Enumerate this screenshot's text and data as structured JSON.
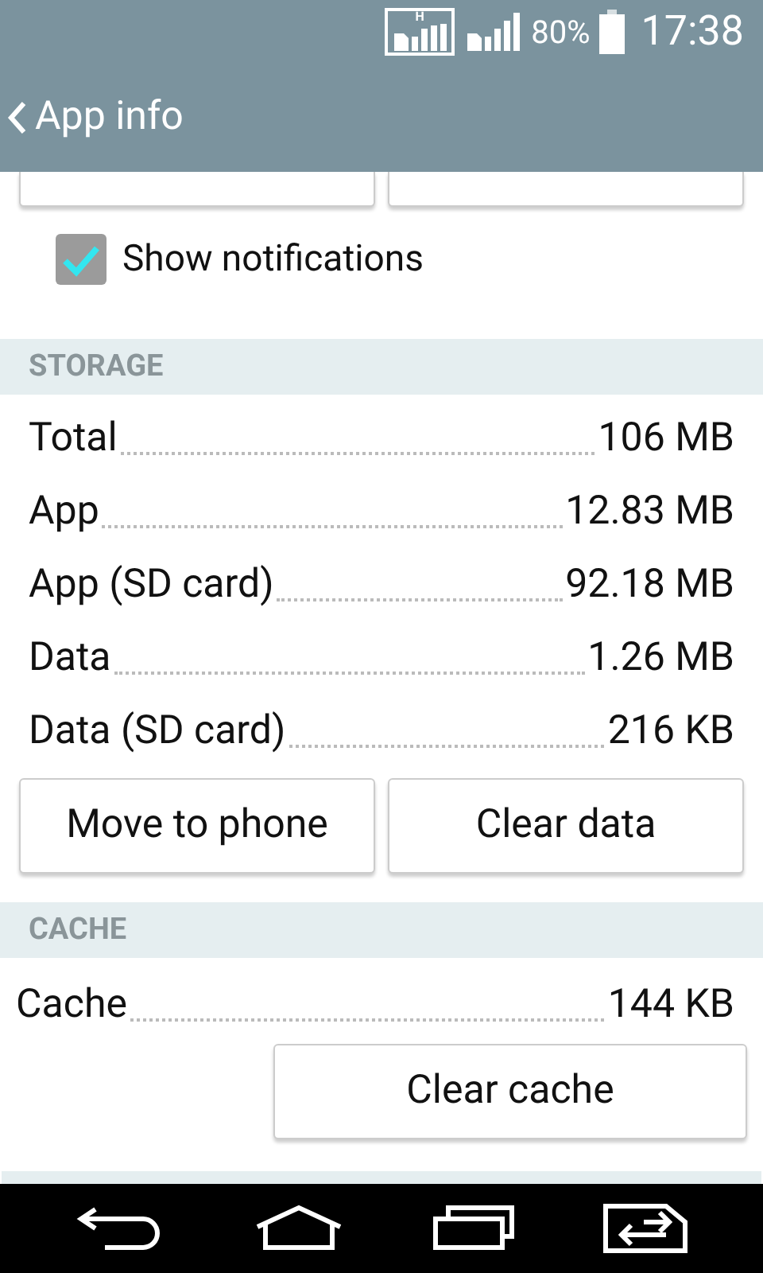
{
  "status_bar": {
    "network": "H",
    "battery": "80%",
    "time": "17:38"
  },
  "header": {
    "title": "App info"
  },
  "top_buttons": [
    {
      "kind": "cut"
    },
    {
      "kind": "cut"
    }
  ],
  "notifications": {
    "label": "Show notifications",
    "checked": true
  },
  "storage": {
    "heading": "STORAGE",
    "rows": [
      {
        "label": "Total",
        "value": "106 MB"
      },
      {
        "label": "App",
        "value": "12.83 MB"
      },
      {
        "label": "App (SD card)",
        "value": "92.18 MB"
      },
      {
        "label": "Data",
        "value": "1.26 MB"
      },
      {
        "label": "Data (SD card)",
        "value": "216 KB"
      }
    ],
    "buttons": [
      "Move to phone",
      "Clear data"
    ]
  },
  "cache": {
    "heading": "CACHE",
    "rows": [
      {
        "label": "Cache",
        "value": "144 KB"
      }
    ],
    "buttons": [
      "Clear cache"
    ]
  }
}
